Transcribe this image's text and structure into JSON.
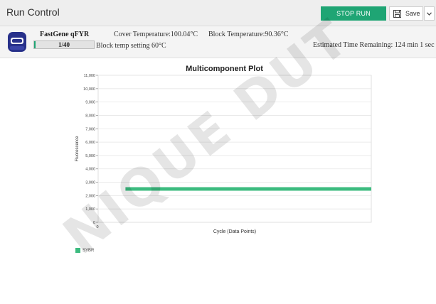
{
  "header": {
    "title": "Run Control",
    "stop_label": "STOP RUN",
    "save_label": "Save",
    "stop_color": "#1fa574"
  },
  "instrument": {
    "name": "FastGene qFYR",
    "progress_label": "1/40",
    "progress_fraction": 0.025,
    "cover_temperature": "Cover Temperature:100.04°C",
    "block_temperature": "Block Temperature:90.36°C",
    "block_setting": "Block temp setting 60°C",
    "time_remaining": "Estimated Time Remaining: 124 min 1 sec",
    "icon": "thermocycler-icon"
  },
  "chart_data": {
    "type": "line",
    "title": "Multicomponent Plot",
    "xlabel": "Cycle (Data Points)",
    "ylabel": "Fluorescence",
    "ylim": [
      0,
      11000
    ],
    "yticks": [
      "0",
      "1,000",
      "2,000",
      "3,000",
      "4,000",
      "5,000",
      "6,000",
      "7,000",
      "8,000",
      "9,000",
      "10,000",
      "11,000"
    ],
    "ytick_values": [
      0,
      1000,
      2000,
      3000,
      4000,
      5000,
      6000,
      7000,
      8000,
      9000,
      10000,
      11000
    ],
    "xticks": [
      "0"
    ],
    "grid": true,
    "legend_position": "bottom-left",
    "series": [
      {
        "name": "SYBR",
        "color": "#3cbb7f",
        "x_range_fraction": [
          0.1,
          1.0
        ],
        "value": 2500
      }
    ]
  },
  "watermark": "NIQUE DUT"
}
